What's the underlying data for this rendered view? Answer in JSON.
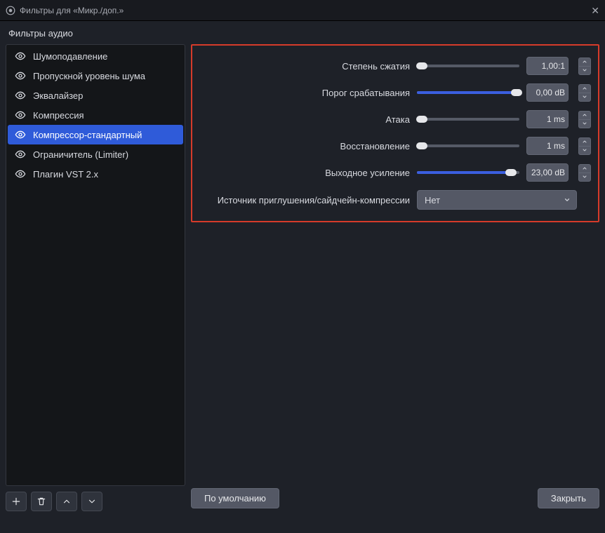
{
  "window": {
    "title": "Фильтры для «Микр./доп.»"
  },
  "section_label": "Фильтры аудио",
  "filters": [
    {
      "label": "Шумоподавление"
    },
    {
      "label": "Пропускной уровень шума"
    },
    {
      "label": "Эквалайзер"
    },
    {
      "label": "Компрессия"
    },
    {
      "label": "Компрессор-стандартный",
      "selected": true
    },
    {
      "label": "Ограничитель (Limiter)"
    },
    {
      "label": "Плагин VST 2.x"
    }
  ],
  "settings": {
    "ratio": {
      "label": "Степень сжатия",
      "value_text": "1,00:1",
      "slider_percent": 0
    },
    "threshold": {
      "label": "Порог срабатывания",
      "value_text": "0,00 dB",
      "slider_percent": 100
    },
    "attack": {
      "label": "Атака",
      "value_text": "1 ms",
      "slider_percent": 0
    },
    "release": {
      "label": "Восстановление",
      "value_text": "1 ms",
      "slider_percent": 0
    },
    "gain": {
      "label": "Выходное усиление",
      "value_text": "23,00 dB",
      "slider_percent": 92
    },
    "sidechain": {
      "label": "Источник приглушения/сайдчейн-компрессии",
      "selected": "Нет"
    }
  },
  "buttons": {
    "defaults": "По умолчанию",
    "close": "Закрыть"
  }
}
